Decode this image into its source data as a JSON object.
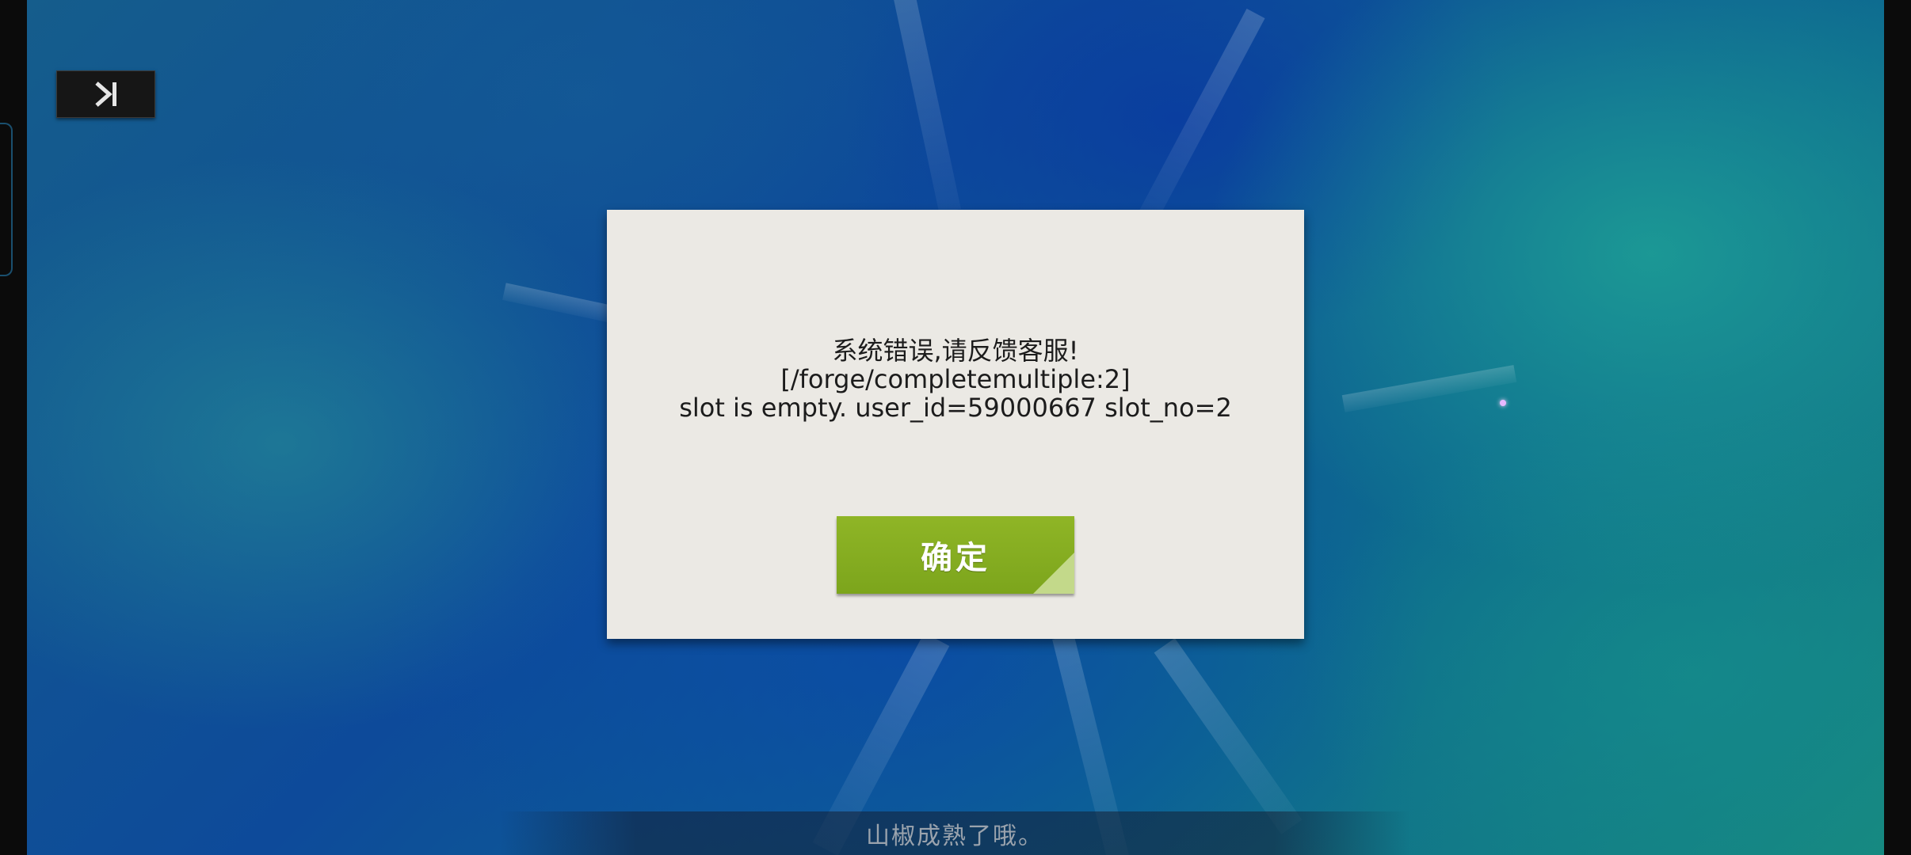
{
  "skip_button": {
    "icon": "skip-to-end-icon"
  },
  "dialog": {
    "message_lines": [
      "系统错误,请反馈客服!",
      "[/forge/completemultiple:2]",
      "slot is empty. user_id=59000667 slot_no=2"
    ],
    "confirm_label": "确定"
  },
  "subtitle": {
    "text": "山椒成熟了哦。"
  },
  "colors": {
    "dialog_bg": "#ebe9e4",
    "confirm_green": "#82aa1f",
    "background_blue": "#0d4a9a",
    "background_teal": "#17897f"
  }
}
